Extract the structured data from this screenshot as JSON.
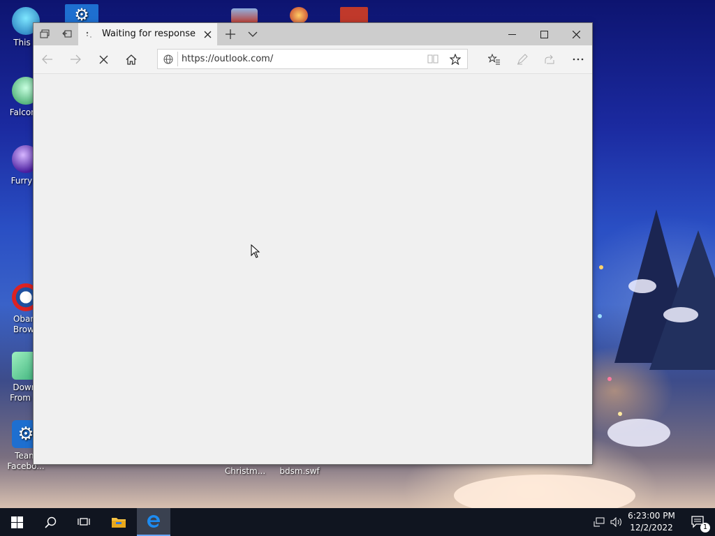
{
  "desktop": {
    "icons": [
      {
        "label": "This P",
        "label2": ""
      },
      {
        "label": "Falcon (",
        "label2": ""
      },
      {
        "label": "Furry C",
        "label2": ""
      },
      {
        "label": "Obam",
        "label2": "Brows"
      },
      {
        "label": "Downl",
        "label2": "From te"
      },
      {
        "label": "Team",
        "label2": "Facebo..."
      },
      {
        "label": "Christm...",
        "label2": ""
      },
      {
        "label": "bdsm.swf",
        "label2": ""
      }
    ]
  },
  "browser": {
    "tab": {
      "title": "Waiting for response fro"
    },
    "address": {
      "url": "https://outlook.com/"
    }
  },
  "taskbar": {
    "time": "6:23:00 PM",
    "date": "12/2/2022",
    "notifications_count": "1"
  }
}
